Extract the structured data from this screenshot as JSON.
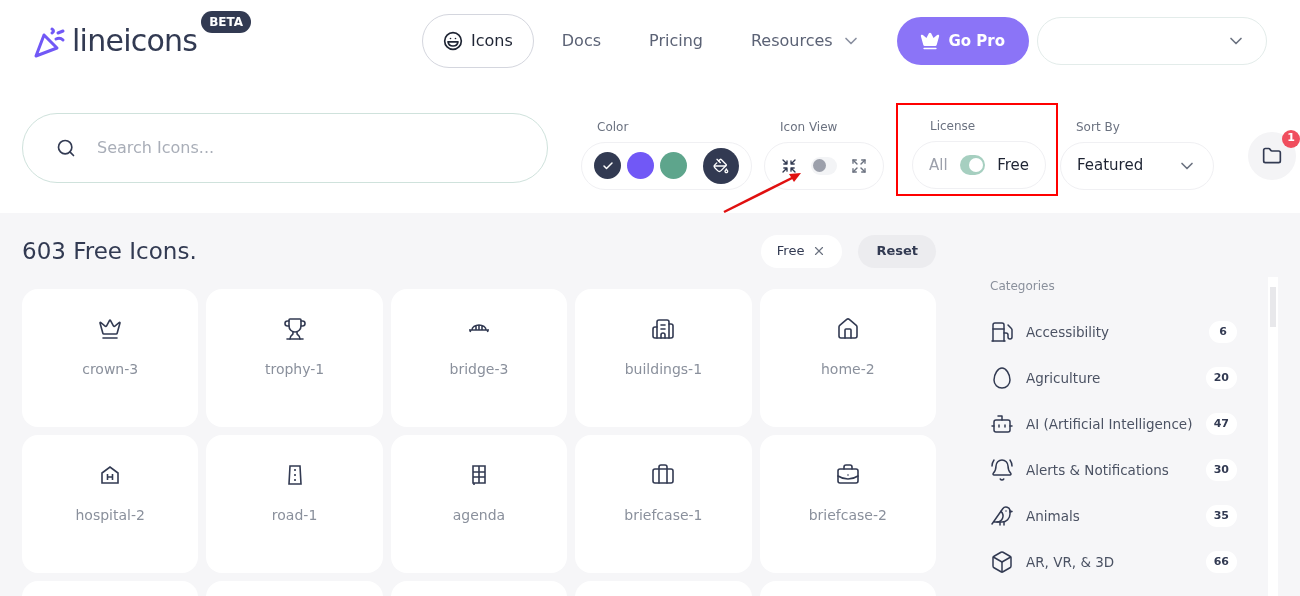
{
  "logo": {
    "name": "lineicons",
    "badge": "BETA"
  },
  "nav": [
    {
      "label": "Icons",
      "selected": true,
      "kind": "pill"
    },
    {
      "label": "Docs",
      "selected": false,
      "kind": "link"
    },
    {
      "label": "Pricing",
      "selected": false,
      "kind": "link"
    },
    {
      "label": "Resources",
      "selected": false,
      "kind": "menu"
    }
  ],
  "go_pro": {
    "label": "Go Pro"
  },
  "search": {
    "placeholder": "Search Icons..."
  },
  "color": {
    "label": "Color",
    "swatches": [
      {
        "color": "#323a52",
        "selected": true
      },
      {
        "color": "#7158f6",
        "selected": false
      },
      {
        "color": "#5ea58c",
        "selected": false
      }
    ]
  },
  "icon_view": {
    "label": "Icon View",
    "on": false
  },
  "license": {
    "label": "License",
    "off_label": "All",
    "on_label": "Free",
    "on": true
  },
  "sort": {
    "label": "Sort By",
    "value": "Featured"
  },
  "folder": {
    "badge": "1"
  },
  "results": {
    "title": "603 Free Icons.",
    "filter_chip": "Free",
    "reset": "Reset"
  },
  "icons": [
    {
      "name": "crown-3",
      "kind": "crown"
    },
    {
      "name": "trophy-1",
      "kind": "trophy"
    },
    {
      "name": "bridge-3",
      "kind": "bridge"
    },
    {
      "name": "buildings-1",
      "kind": "buildings"
    },
    {
      "name": "home-2",
      "kind": "home"
    },
    {
      "name": "hospital-2",
      "kind": "hospital"
    },
    {
      "name": "road-1",
      "kind": "road"
    },
    {
      "name": "agenda",
      "kind": "agenda"
    },
    {
      "name": "briefcase-1",
      "kind": "briefcase"
    },
    {
      "name": "briefcase-2",
      "kind": "briefcase2"
    }
  ],
  "categories": {
    "title": "Categories",
    "items": [
      {
        "label": "Accessibility",
        "count": "6",
        "kind": "fuel"
      },
      {
        "label": "Agriculture",
        "count": "20",
        "kind": "seed"
      },
      {
        "label": "AI (Artificial Intelligence)",
        "count": "47",
        "kind": "robot"
      },
      {
        "label": "Alerts & Notifications",
        "count": "30",
        "kind": "bell"
      },
      {
        "label": "Animals",
        "count": "35",
        "kind": "bat"
      },
      {
        "label": "AR, VR, & 3D",
        "count": "66",
        "kind": "cube"
      }
    ]
  }
}
